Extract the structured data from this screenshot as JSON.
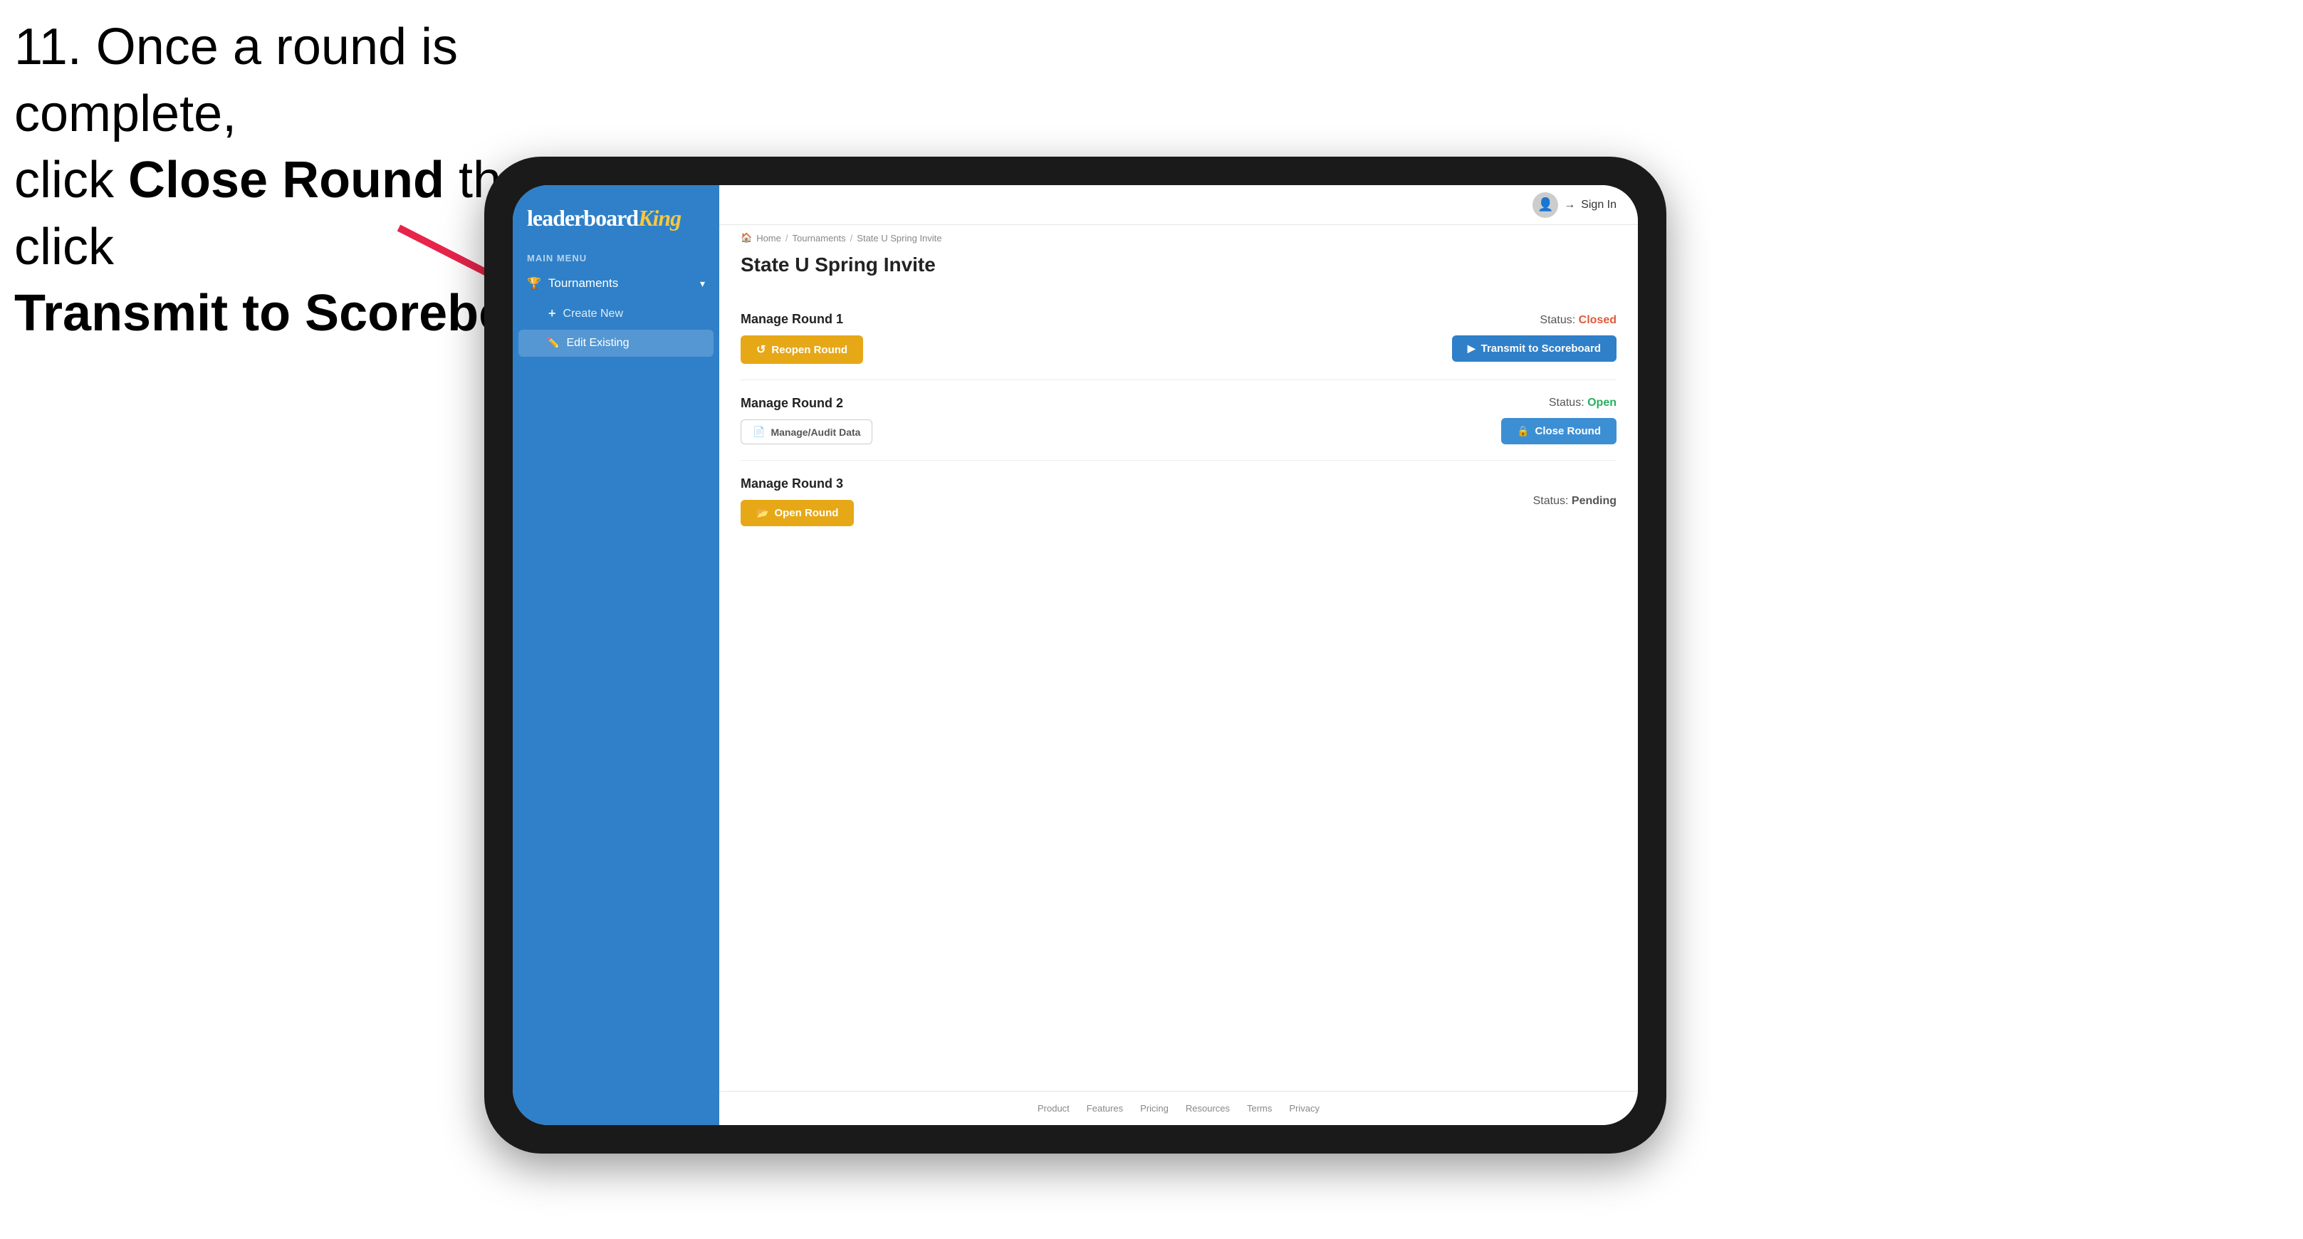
{
  "instruction": {
    "line1": "11. Once a round is complete,",
    "line2": "click ",
    "bold1": "Close Round",
    "line3": " then click",
    "bold2": "Transmit to Scoreboard."
  },
  "app": {
    "logo": {
      "leaderboard": "leaderboard",
      "king": "King"
    },
    "sidebar": {
      "main_menu_label": "MAIN MENU",
      "tournaments_label": "Tournaments",
      "create_new_label": "Create New",
      "edit_existing_label": "Edit Existing"
    },
    "topnav": {
      "sign_in_label": "Sign In"
    },
    "breadcrumb": {
      "home": "Home",
      "tournaments": "Tournaments",
      "current": "State U Spring Invite"
    },
    "page_title": "State U Spring Invite",
    "rounds": [
      {
        "label": "Manage Round 1",
        "status_label": "Status:",
        "status_value": "Closed",
        "status_class": "status-closed",
        "button1_label": "Reopen Round",
        "button1_class": "btn-orange",
        "button2_label": "Transmit to Scoreboard",
        "button2_class": "btn-blue",
        "show_audit": false
      },
      {
        "label": "Manage Round 2",
        "status_label": "Status:",
        "status_value": "Open",
        "status_class": "status-open",
        "button1_label": "Manage/Audit Data",
        "button1_class": "btn-audit",
        "button2_label": "Close Round",
        "button2_class": "btn-blue-light",
        "show_audit": true
      },
      {
        "label": "Manage Round 3",
        "status_label": "Status:",
        "status_value": "Pending",
        "status_class": "status-pending",
        "button1_label": "Open Round",
        "button1_class": "btn-orange",
        "button2_label": "",
        "show_audit": false
      }
    ],
    "footer": {
      "links": [
        "Product",
        "Features",
        "Pricing",
        "Resources",
        "Terms",
        "Privacy"
      ]
    }
  }
}
